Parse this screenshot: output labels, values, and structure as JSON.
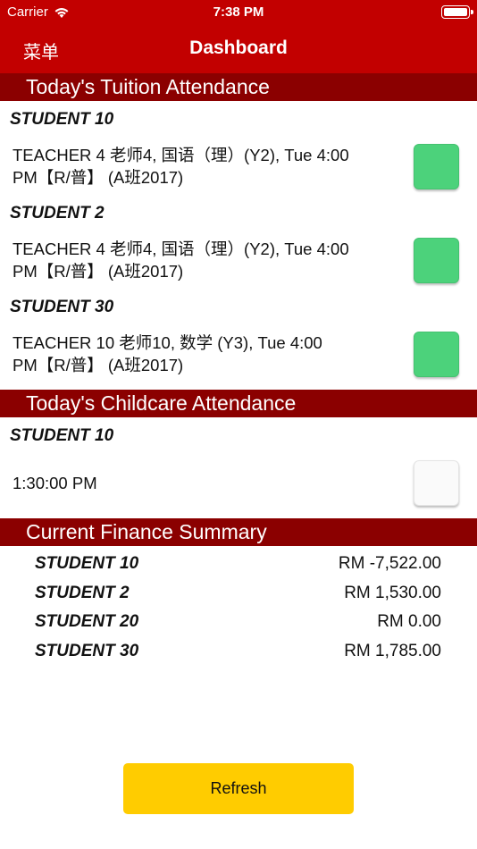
{
  "status_bar": {
    "carrier": "Carrier",
    "time": "7:38 PM"
  },
  "nav": {
    "menu_label": "菜单",
    "title": "Dashboard"
  },
  "tuition": {
    "header": "Today's Tuition Attendance",
    "entries": [
      {
        "student": "STUDENT 10",
        "lesson_line1": "TEACHER 4 老师4, 国语（理）(Y2), Tue 4:00",
        "lesson_line2": "PM【R/普】 (A班2017)",
        "attended": true
      },
      {
        "student": "STUDENT 2",
        "lesson_line1": "TEACHER 4 老师4, 国语（理）(Y2), Tue 4:00",
        "lesson_line2": "PM【R/普】 (A班2017)",
        "attended": true
      },
      {
        "student": "STUDENT 30",
        "lesson_line1": "TEACHER 10 老师10, 数学 (Y3), Tue 4:00",
        "lesson_line2": "PM【R/普】 (A班2017)",
        "attended": true
      }
    ]
  },
  "childcare": {
    "header": "Today's Childcare Attendance",
    "entries": [
      {
        "student": "STUDENT 10",
        "time": "1:30:00 PM",
        "attended": false
      }
    ]
  },
  "finance": {
    "header": "Current Finance Summary",
    "rows": [
      {
        "student": "STUDENT 10",
        "amount": "RM -7,522.00"
      },
      {
        "student": "STUDENT 2",
        "amount": "RM 1,530.00"
      },
      {
        "student": "STUDENT 20",
        "amount": "RM 0.00"
      },
      {
        "student": "STUDENT 30",
        "amount": "RM 1,785.00"
      }
    ]
  },
  "actions": {
    "refresh_label": "Refresh"
  },
  "colors": {
    "nav_red": "#c20000",
    "section_red": "#8b0000",
    "check_green": "#4cd27b",
    "button_yellow": "#ffcc00"
  }
}
